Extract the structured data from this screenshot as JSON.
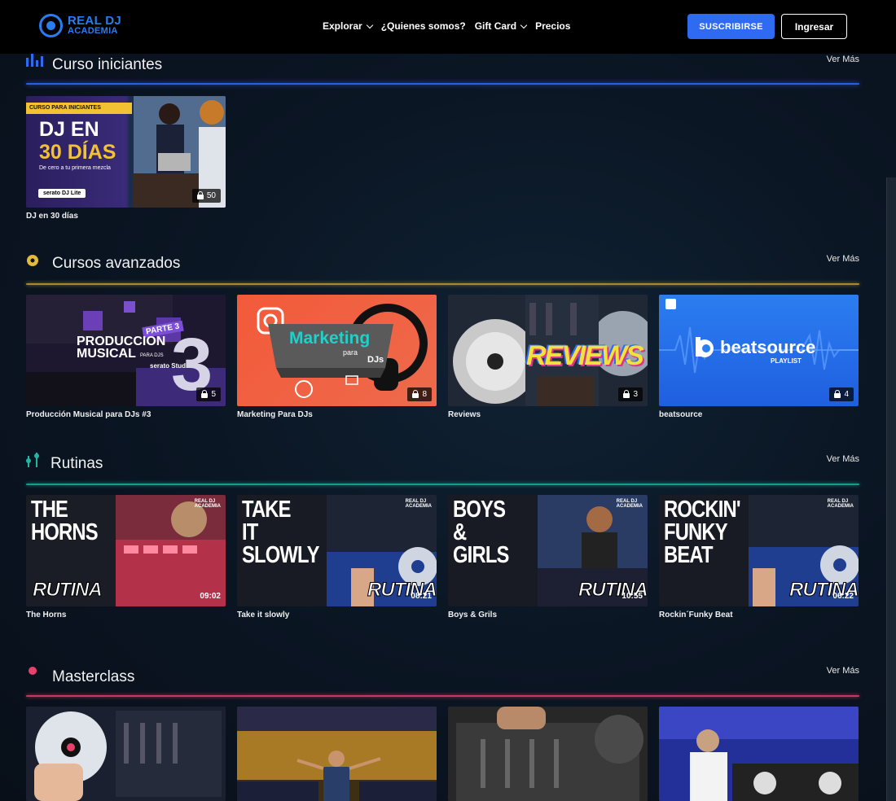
{
  "header": {
    "logo_line1": "REAL DJ",
    "logo_line2": "ACADEMIA",
    "nav": [
      {
        "label": "Explorar",
        "dropdown": true
      },
      {
        "label": "¿Quienes somos?",
        "dropdown": false
      },
      {
        "label": "Gift Card",
        "dropdown": true
      },
      {
        "label": "Precios",
        "dropdown": false
      }
    ],
    "subscribe_label": "SUSCRIBIRSE",
    "login_label": "Ingresar",
    "accent_color": "#2f6bf2"
  },
  "sections": [
    {
      "title": "Curso iniciantes",
      "more": "Ver Más",
      "color": "#2f6bf2",
      "icon": "bars-icon",
      "cards": [
        {
          "label": "DJ en 30 días",
          "count": "50",
          "banner": "CURSO PARA INICIANTES",
          "title_line1": "DJ EN",
          "title_line2": "30 DÍAS",
          "subtitle": "De cero a tu primera mezcla",
          "brand": "serato DJ Lite"
        }
      ]
    },
    {
      "title": "Cursos avanzados",
      "more": "Ver Más",
      "color": "#e2b93b",
      "icon": "vinyl-icon",
      "cards": [
        {
          "label": "Producción Musical para DJs #3",
          "count": "5",
          "art_tag": "PARTE 3",
          "art_line1": "PRODUCCION",
          "art_line2": "MUSICAL",
          "art_small": "PARA DJS",
          "art_brand": "serato Studio",
          "art_num": "3"
        },
        {
          "label": "Marketing Para DJs",
          "count": "8",
          "art_line1": "Marketing",
          "art_line2": "para",
          "art_line3": "DJs"
        },
        {
          "label": "Reviews",
          "count": "3",
          "art_line1": "REVIEWS"
        },
        {
          "label": "beatsource",
          "count": "4",
          "art_line1": "beatsource",
          "art_line2": "PLAYLIST"
        }
      ]
    },
    {
      "title": "Rutinas",
      "more": "Ver Más",
      "color": "#1fb7a3",
      "icon": "equalizer-icon",
      "cards": [
        {
          "label": "The Horns",
          "duration": "09:02",
          "art_text": "THE HORNS",
          "art_tag": "RUTINA"
        },
        {
          "label": "Take it slowly",
          "duration": "08:21",
          "art_text": "TAKE IT SLOWLY",
          "art_tag": "RUTINA"
        },
        {
          "label": "Boys & Grils",
          "duration": "10:55",
          "art_text": "BOYS & GIRLS",
          "art_tag": "RUTINA"
        },
        {
          "label": "Rockin´Funky Beat",
          "duration": "06:22",
          "art_text": "ROCKIN' FUNKY BEAT",
          "art_tag": "RUTINA"
        }
      ]
    },
    {
      "title": "Masterclass",
      "more": "Ver Más",
      "color": "#e8416c",
      "icon": "dot-icon",
      "cards": [
        {
          "label": ""
        },
        {
          "label": ""
        },
        {
          "label": ""
        },
        {
          "label": ""
        }
      ]
    }
  ],
  "small_logo_line1": "REAL DJ",
  "small_logo_line2": "ACADEMIA"
}
